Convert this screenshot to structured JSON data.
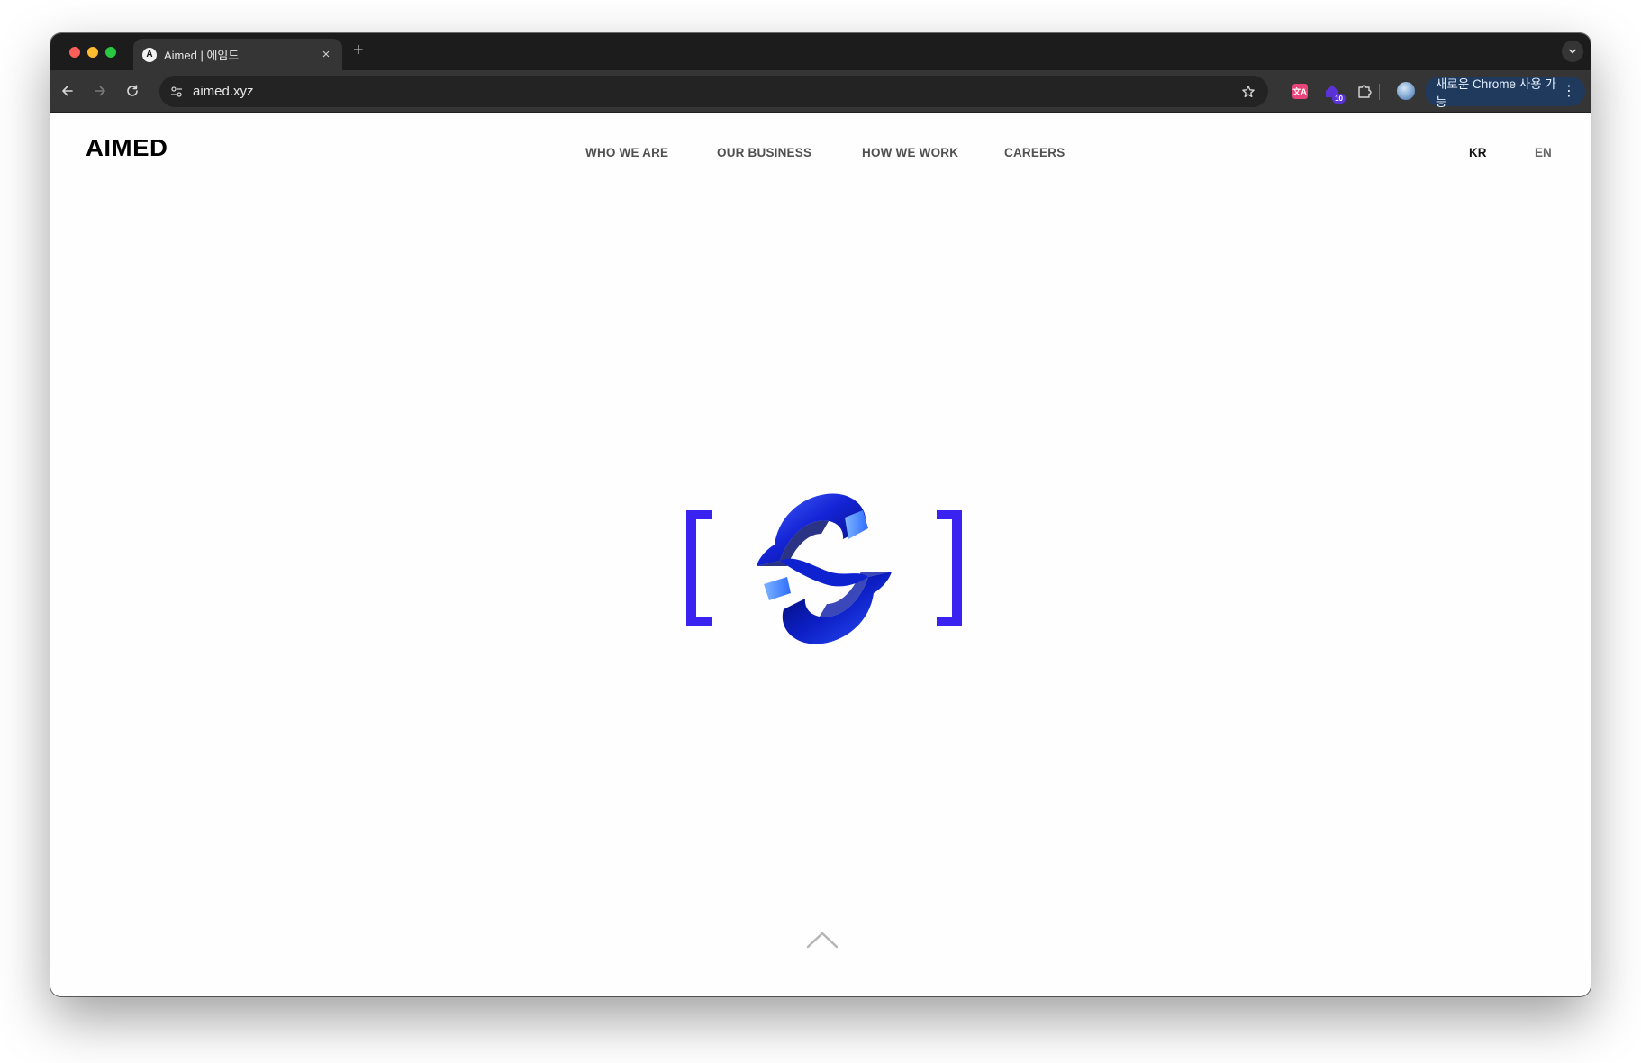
{
  "browser": {
    "tab": {
      "favicon_letter": "A",
      "title": "Aimed | 에임드",
      "close": "×"
    },
    "new_tab": "+",
    "url": "aimed.xyz",
    "extensions": [
      {
        "name": "translate-extension",
        "glyph": "文A",
        "color": "#e8447a"
      },
      {
        "name": "house-extension",
        "badge": "10",
        "color": "#5a33d8"
      },
      {
        "name": "puzzle-icon"
      }
    ],
    "update_chip": {
      "label": "새로운 Chrome 사용 가능",
      "menu": "⋮"
    },
    "accent": "#1f3a5d"
  },
  "site": {
    "logo": "AIMED",
    "nav": [
      {
        "label": "WHO WE ARE"
      },
      {
        "label": "OUR BUSINESS"
      },
      {
        "label": "HOW WE WORK"
      },
      {
        "label": "CAREERS"
      }
    ],
    "languages": [
      {
        "code": "KR",
        "active": true
      },
      {
        "code": "EN",
        "active": false
      }
    ],
    "hero": {
      "bracket_color": "#3a22f0",
      "emblem_color": "#1b2ae8",
      "emblem": "3d-s-emblem"
    },
    "scroll_top_icon": "chevron-up-icon"
  }
}
